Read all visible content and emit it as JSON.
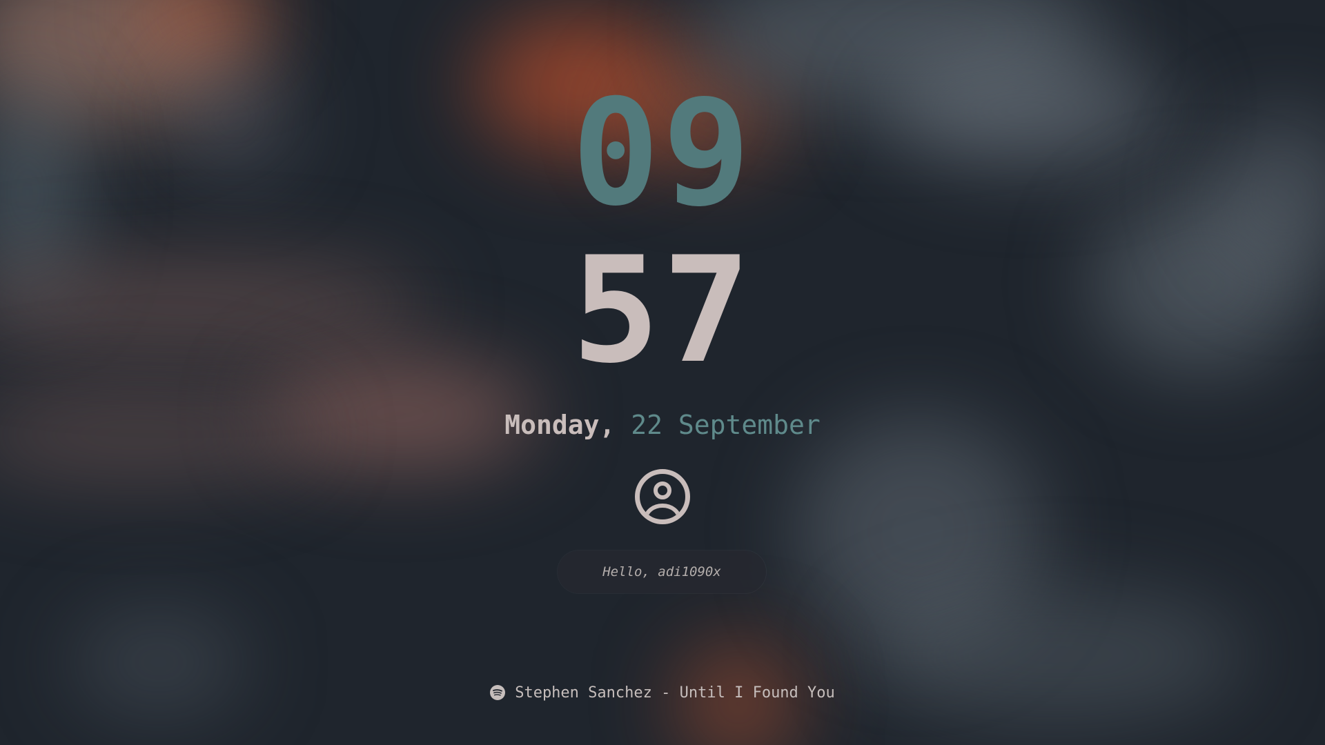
{
  "clock": {
    "hour": "09",
    "minute": "57"
  },
  "date": {
    "weekday": "Monday,",
    "day_month": "22 September"
  },
  "user": {
    "avatar_icon": "user-circle-icon",
    "greeting": "Hello, adi1090x"
  },
  "media": {
    "icon": "spotify-icon",
    "now_playing": "Stephen Sanchez - Until I Found You"
  },
  "colors": {
    "background": "#1f252d",
    "accent_teal": "#527a7c",
    "text_light": "#c9bdbb",
    "wallpaper_orange": "#a2452b"
  }
}
